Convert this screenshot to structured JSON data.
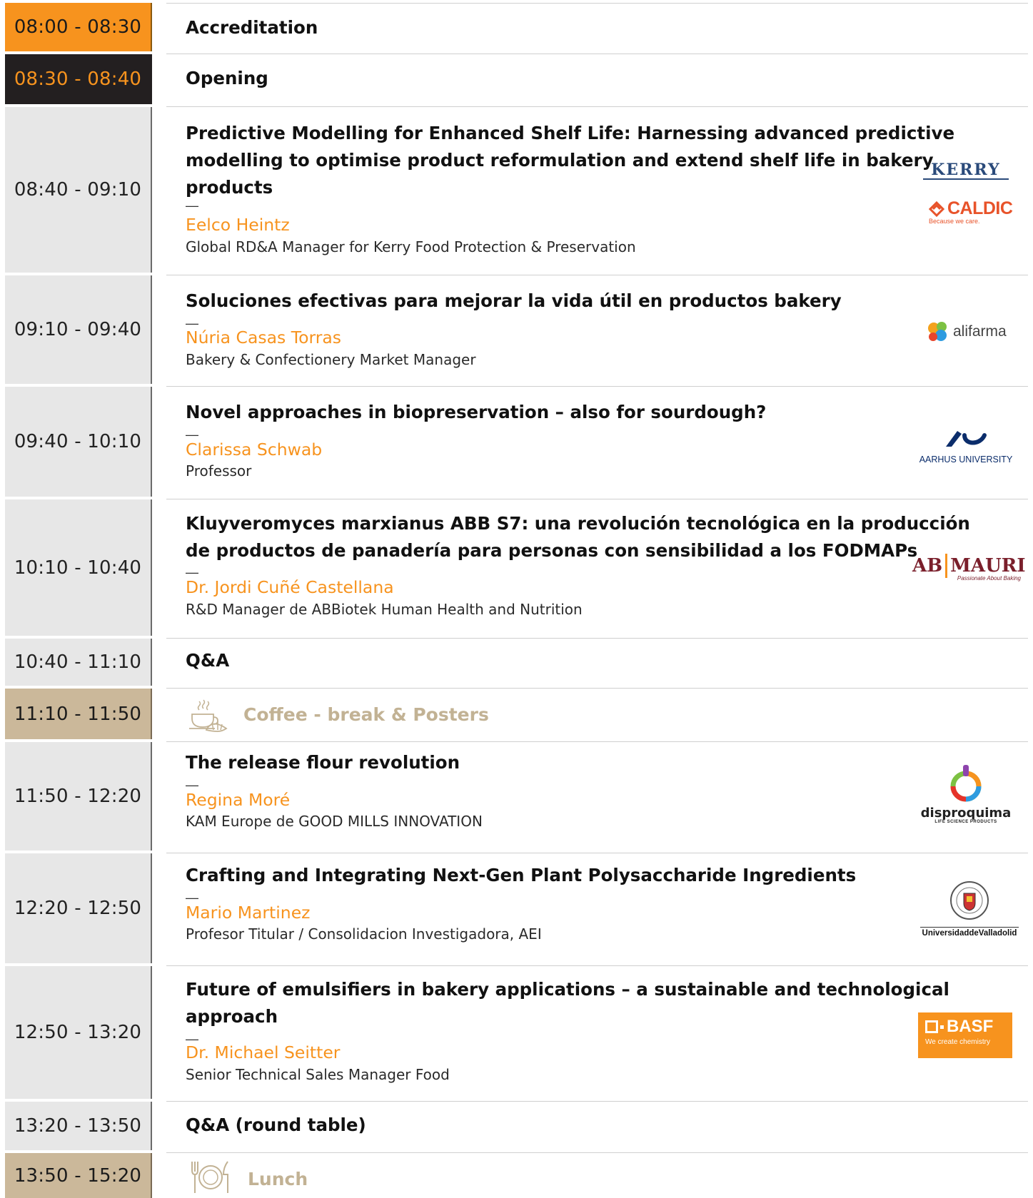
{
  "sessions": [
    {
      "time": "08:00 - 08:30",
      "title": "Accreditation"
    },
    {
      "time": "08:30 - 08:40",
      "title": "Opening"
    },
    {
      "time": "08:40 - 09:10",
      "title_lines": [
        "Predictive Modelling for Enhanced Shelf Life: Harnessing advanced predictive",
        "modelling to optimise product reformulation and extend shelf life in bakery",
        "products"
      ],
      "speaker": "Eelco Heintz",
      "role": "Global RD&A Manager for Kerry Food Protection & Preservation",
      "logos": [
        {
          "name": "KERRY"
        },
        {
          "name": "CALDIC",
          "tagline": "Because we care."
        }
      ]
    },
    {
      "time": "09:10 - 09:40",
      "title_lines": [
        "Soluciones efectivas para mejorar la vida útil en productos bakery"
      ],
      "speaker": "Núria Casas Torras",
      "role": "Bakery & Confectionery Market Manager",
      "logos": [
        {
          "name": "alifarma"
        }
      ]
    },
    {
      "time": "09:40 - 10:10",
      "title_lines": [
        "Novel approaches in biopreservation – also for sourdough?"
      ],
      "speaker": "Clarissa Schwab",
      "role": "Professor",
      "logos": [
        {
          "name": "AARHUS UNIVERSITY"
        }
      ]
    },
    {
      "time": "10:10 - 10:40",
      "title_lines": [
        "Kluyveromyces marxianus ABB S7: una revolución tecnológica en la producción",
        "de productos de panadería para personas con sensibilidad a los FODMAPs"
      ],
      "speaker": "Dr. Jordi Cuñé Castellana",
      "role": "R&D Manager de ABBiotek Human Health and Nutrition",
      "logos": [
        {
          "name": "AB",
          "name2": "MAURI",
          "tagline": "Passionate About Baking"
        }
      ]
    },
    {
      "time": "10:40 - 11:10",
      "title": "Q&A"
    },
    {
      "time": "11:10 - 11:50",
      "title": "Coffee - break & Posters"
    },
    {
      "time": "11:50 - 12:20",
      "title_lines": [
        "The release flour revolution"
      ],
      "speaker": "Regina Moré",
      "role": "KAM Europe de GOOD MILLS INNOVATION",
      "logos": [
        {
          "name": "disproquima",
          "tagline": "LIFE SCIENCE PRODUCTS"
        }
      ]
    },
    {
      "time": "12:20 - 12:50",
      "title_lines": [
        "Crafting and Integrating Next-Gen Plant Polysaccharide Ingredients"
      ],
      "speaker": "Mario Martinez",
      "role": "Profesor Titular / Consolidacion Investigadora, AEI",
      "logos": [
        {
          "name": "UniversidaddeValladolid"
        }
      ]
    },
    {
      "time": "12:50 - 13:20",
      "title_lines": [
        "Future of emulsifiers in bakery applications – a sustainable and technological",
        "approach"
      ],
      "speaker": "Dr. Michael Seitter",
      "role": "Senior Technical Sales Manager Food",
      "logos": [
        {
          "name": "BASF",
          "tagline": "We create chemistry"
        }
      ]
    },
    {
      "time": "13:20 - 13:50",
      "title": "Q&A (round table)"
    },
    {
      "time": "13:50 - 15:20",
      "title": "Lunch"
    }
  ],
  "dash": "—",
  "colors": {
    "accent": "#f7931e",
    "dark": "#231f20",
    "tan": "#cbb89a",
    "grey": "#e7e7e7"
  }
}
